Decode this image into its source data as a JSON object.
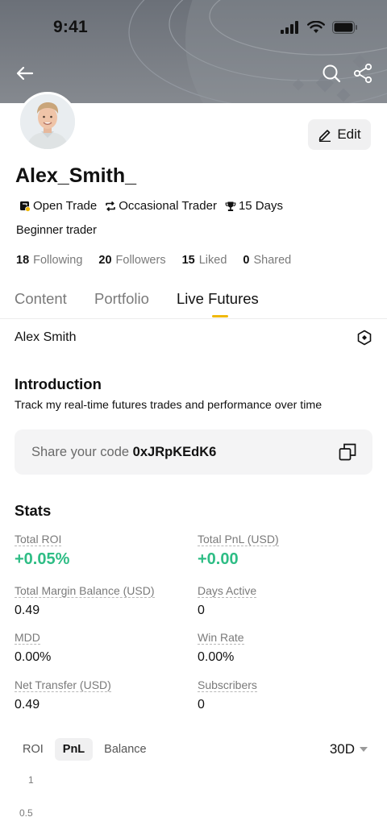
{
  "status_bar": {
    "time": "9:41"
  },
  "profile": {
    "username": "Alex_Smith_",
    "edit_label": "Edit",
    "badges": [
      {
        "label": "Open Trade",
        "icon": "open-trade-icon"
      },
      {
        "label": "Occasional Trader",
        "icon": "repeat-icon"
      },
      {
        "label": "15 Days",
        "icon": "trophy-icon"
      }
    ],
    "bio": "Beginner trader",
    "counts": [
      {
        "num": "18",
        "label": "Following"
      },
      {
        "num": "20",
        "label": "Followers"
      },
      {
        "num": "15",
        "label": "Liked"
      },
      {
        "num": "0",
        "label": "Shared"
      }
    ]
  },
  "tabs": [
    "Content",
    "Portfolio",
    "Live Futures"
  ],
  "active_tab": "Live Futures",
  "owner": {
    "name": "Alex Smith"
  },
  "introduction": {
    "title": "Introduction",
    "text": "Track my real-time futures trades and performance over time"
  },
  "share": {
    "prefix": "Share your code",
    "code": "0xJRpKEdK6"
  },
  "stats": {
    "title": "Stats",
    "items": [
      {
        "label": "Total ROI",
        "value": "+0.05%"
      },
      {
        "label": "Total PnL (USD)",
        "value": "+0.00"
      },
      {
        "label": "Total Margin Balance (USD)",
        "value": "0.49"
      },
      {
        "label": "Days Active",
        "value": "0"
      },
      {
        "label": "MDD",
        "value": "0.00%"
      },
      {
        "label": "Win Rate",
        "value": "0.00%"
      },
      {
        "label": "Net Transfer (USD)",
        "value": "0.49"
      },
      {
        "label": "Subscribers",
        "value": "0"
      }
    ]
  },
  "chart": {
    "tabs": [
      "ROI",
      "PnL",
      "Balance"
    ],
    "active_tab": "PnL",
    "period": "30D",
    "y_ticks": [
      "1",
      "0.5"
    ]
  },
  "colors": {
    "positive": "#2ebd85",
    "accent": "#f0b90b"
  }
}
